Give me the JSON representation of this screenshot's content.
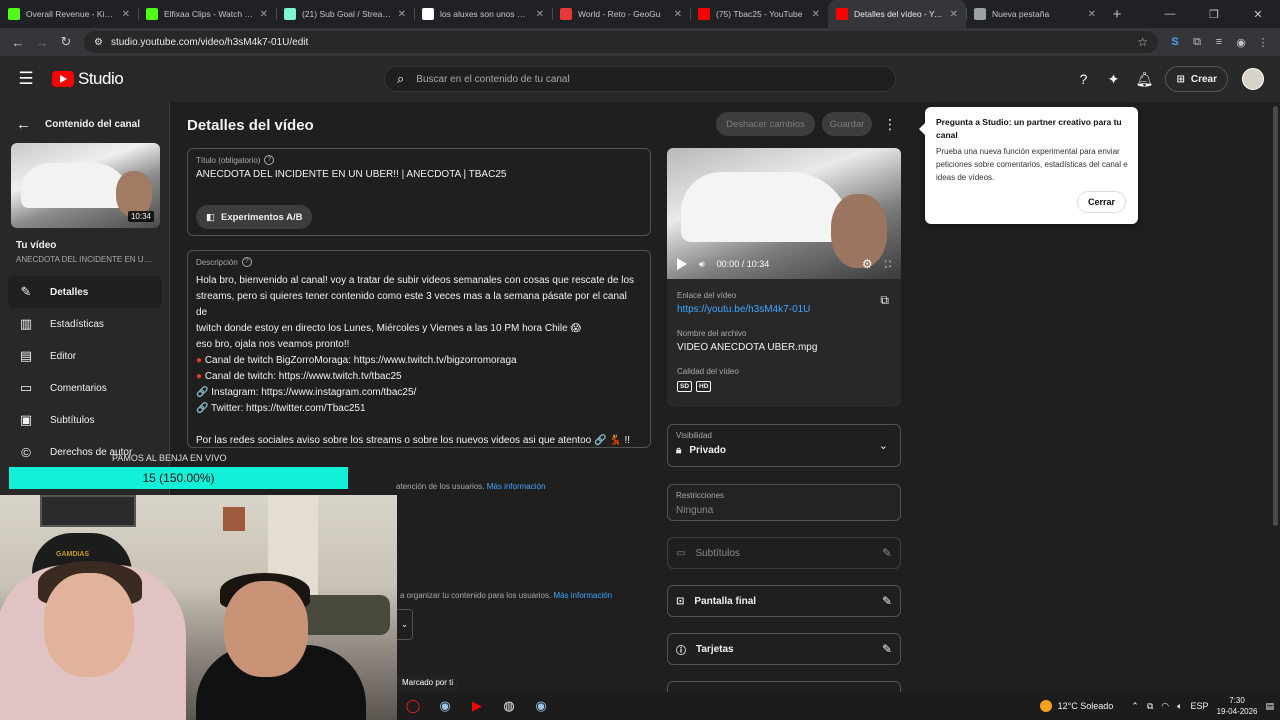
{
  "browser": {
    "tabs": [
      {
        "title": "Overall Revenue - Kick Da",
        "color": "#53fc18"
      },
      {
        "title": "Elfixaa Clips - Watch Live",
        "color": "#53fc18"
      },
      {
        "title": "(21) Sub Goal / Streamlab",
        "color": "#80f5d2"
      },
      {
        "title": "los aluxes son unos ente",
        "color": "#ffffff"
      },
      {
        "title": "World - Reto - GeoGu",
        "color": "#e53935"
      },
      {
        "title": "(75) Tbac25 - YouTube",
        "color": "#ff0000"
      },
      {
        "title": "Detalles del vídeo - YouTu",
        "color": "#ff0000",
        "active": true
      },
      {
        "title": "Nueva pestaña",
        "color": "#9aa0a6"
      }
    ],
    "url": "studio.youtube.com/video/h3sM4k7-01U/edit"
  },
  "header": {
    "logo": "Studio",
    "search_placeholder": "Buscar en el contenido de tu canal",
    "create_label": "Crear"
  },
  "sidebar": {
    "back_label": "Contenido del canal",
    "thumb_duration": "10:34",
    "your_video": "Tu vídeo",
    "video_title": "ANECDOTA DEL INCIDENTE EN UN ...",
    "items": [
      {
        "label": "Detalles",
        "icon": "pencil-icon"
      },
      {
        "label": "Estadísticas",
        "icon": "analytics-icon"
      },
      {
        "label": "Editor",
        "icon": "editor-icon"
      },
      {
        "label": "Comentarios",
        "icon": "comments-icon"
      },
      {
        "label": "Subtítulos",
        "icon": "subtitles-icon"
      },
      {
        "label": "Derechos de autor",
        "icon": "copyright-icon"
      }
    ]
  },
  "main": {
    "page_title": "Detalles del vídeo",
    "undo_label": "Deshacer cambios",
    "save_label": "Guardar",
    "title_label": "Título (obligatorio)",
    "title_value": "ANECDOTA DEL INCIDENTE EN UN UBER!! | ANECDOTA | TBAC25",
    "ab_label": "Experimentos A/B",
    "desc_label": "Descripción",
    "desc_lines": [
      "Hola bro, bienvenido al canal! voy a tratar de subir videos semanales con cosas que rescate de los",
      "streams, pero si quieres tener contenido como este 3 veces mas a la semana pásate por el canal de",
      "twitch donde estoy en directo los Lunes, Miércoles y Viernes a las 10 PM hora Chile 😱",
      "eso bro, ojala nos veamos pronto!!",
      "🔴 Canal de twitch BigZorroMoraga: https://www.twitch.tv/bigzorromoraga",
      "🔴 Canal de twitch: https://www.twitch.tv/tbac25",
      "🔗 Instagram: https://www.instagram.com/tbac25/",
      "🔗 Twitter: https://twitter.com/Tbac251",
      "",
      "Por las redes sociales aviso sobre los streams o sobre los nuevos videos asi que atentoo 🔗 💃 !!"
    ],
    "thumb_hint": "atención de los usuarios.",
    "thumb_more": "Más información",
    "playlist_hint": "a organizar tu contenido para los usuarios.",
    "playlist_more": "Más información"
  },
  "player": {
    "time": "00:00 / 10:34",
    "link_label": "Enlace del vídeo",
    "link": "https://youtu.be/h3sM4k7-01U",
    "filename_label": "Nombre del archivo",
    "filename": "VIDEO ANECDOTA UBER.mpg",
    "quality_label": "Calidad del vídeo",
    "quality_badges": [
      "SD",
      "HD"
    ]
  },
  "settings": {
    "visibility_label": "Visibilidad",
    "visibility_value": "Privado",
    "restrictions_label": "Restricciones",
    "restrictions_value": "Ninguna",
    "subtitles": "Subtítulos",
    "end_screen": "Pantalla final",
    "cards": "Tarjetas"
  },
  "popup": {
    "title": "Pregunta a Studio: un partner creativo para tu canal",
    "body": "Prueba una nueva función experimental para enviar peticiones sobre comentarios, estadísticas del canal e ideas de vídeos.",
    "close": "Cerrar"
  },
  "stream_overlay": {
    "goal_text": "15 (150.00%)",
    "goal_color": "#13f0d8",
    "caption": "PAMOS AL BENJA EN VIVO",
    "chair_text": "GAMDIAS",
    "tooltip": "Marcado por ti"
  },
  "taskbar": {
    "weather": "12°C Soleado",
    "lang": "ESP",
    "time": "7:30",
    "date": "19-04-2026"
  }
}
